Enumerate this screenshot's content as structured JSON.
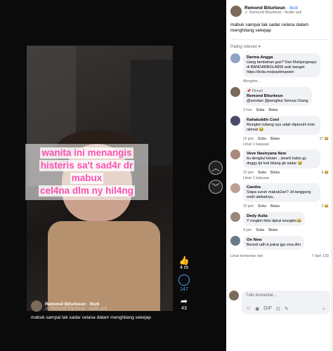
{
  "viewer": {
    "overlay_lines": [
      "wanita ini menangis",
      "histeris sa't sad4r dr",
      "mabux",
      "cel4na dlm ny hil4ng"
    ],
    "likes": "4 rb",
    "comments": "147",
    "shares": "43",
    "author": "Remond Biturkeun",
    "follow": "· Ikuti",
    "audio": "♬ Remond Biturkeun · Audio asli",
    "caption": "mabuk sampai tak sadar celana dalam menghilang sekejap"
  },
  "panel": {
    "author": "Remond Biturkeun",
    "follow": "· Ikuti",
    "audio": "♬ Remond Biturkeun · Audio asli",
    "post_text": "mabuk sampai tak sadar celana dalam menghilang sekejap",
    "sort_label": "Paling relevan ▾",
    "comments": [
      {
        "name": "Darma Angga",
        "text": "Uang tambahan gue? Dari Mahjongways di BANDARBOLA855 asik banget https://bola.mx/pastimaxwin",
        "meta": "Mengirim..."
      },
      {
        "pinned": "📌 Pinned",
        "name": "Remond Biturkeun",
        "text": "@sorotan @pengikut Semua Orang",
        "time": "2 hari",
        "like": "Suka",
        "reply": "Balas"
      },
      {
        "name": "Kahaluddin Cool",
        "text": "Mungkin lubang nya udah dipenuhi krim nikmat 😂",
        "time": "22 jam",
        "like": "Suka",
        "reply": "Balas",
        "react": "27 😂",
        "replies": "Lihat 1 balasan"
      },
      {
        "name": "Veve Nastryana New",
        "text": "itu dengkul lebam ...bearti habis gy doggy tpi kok bilang gk sadar 😂",
        "time": "22 jam",
        "like": "Suka",
        "reply": "Balas",
        "react": "6 😂",
        "replies": "Lihat 1 balasan"
      },
      {
        "name": "Candra",
        "text": "Siapa suruh mabuk2an? Jd tanggung sndri akibatnya..",
        "time": "22 jam",
        "like": "Suka",
        "reply": "Balas",
        "react": "2 😂"
      },
      {
        "name": "Dedy Aulia",
        "text": "Y mngkin hbis dpkai mungkin😂",
        "time": "9 jam",
        "like": "Suka",
        "reply": "Balas"
      },
      {
        "name": "On New",
        "text": "Berarti udh d pakai jga cina dlm",
        "time": "",
        "like": "",
        "reply": ""
      }
    ],
    "more_comments": "Lihat komentar lain",
    "count": "7 dari 133",
    "compose_placeholder": "Tulis komentar...",
    "compose_icons": [
      "☺",
      "◉",
      "GIF",
      "⊡",
      "✎"
    ]
  }
}
